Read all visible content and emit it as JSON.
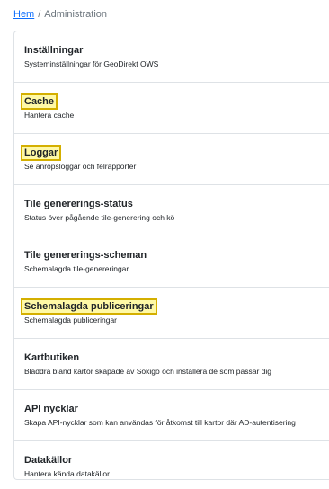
{
  "breadcrumb": {
    "home": "Hem",
    "separator": "/",
    "current": "Administration"
  },
  "colors": {
    "link": "#0d6efd",
    "highlight_fill": "#fff9a6",
    "highlight_border": "#d4af00"
  },
  "items": [
    {
      "title": "Inställningar",
      "description": "Systeminställningar för GeoDirekt OWS",
      "highlighted": false
    },
    {
      "title": "Cache",
      "description": "Hantera cache",
      "highlighted": true
    },
    {
      "title": "Loggar",
      "description": "Se anropsloggar och felrapporter",
      "highlighted": true
    },
    {
      "title": "Tile genererings-status",
      "description": "Status över pågående tile-generering och kö",
      "highlighted": false
    },
    {
      "title": "Tile genererings-scheman",
      "description": "Schemalagda tile-genereringar",
      "highlighted": false
    },
    {
      "title": "Schemalagda publiceringar",
      "description": "Schemalagda publiceringar",
      "highlighted": true
    },
    {
      "title": "Kartbutiken",
      "description": "Bläddra bland kartor skapade av Sokigo och installera de som passar dig",
      "highlighted": false
    },
    {
      "title": "API nycklar",
      "description": "Skapa API-nycklar som kan användas för åtkomst till kartor där AD-autentisering",
      "highlighted": false
    },
    {
      "title": "Datakällor",
      "description": "Hantera kända datakällor",
      "highlighted": false
    }
  ]
}
